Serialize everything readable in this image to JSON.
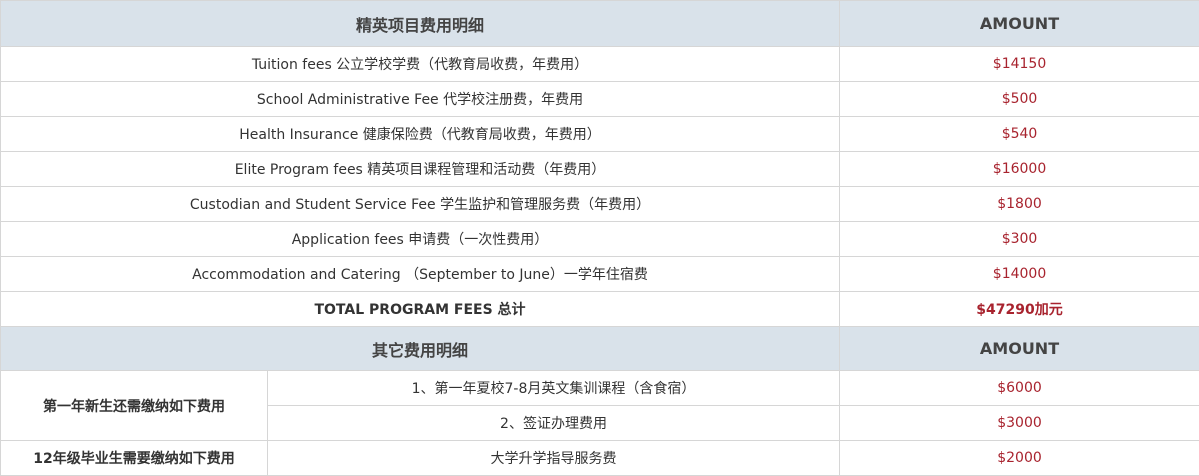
{
  "main_table": {
    "header": {
      "item": "精英项目费用明细",
      "amount": "AMOUNT"
    },
    "rows": [
      {
        "item": "Tuition fees 公立学校学费（代教育局收费，年费用）",
        "amount": "$14150"
      },
      {
        "item": "School Administrative Fee 代学校注册费，年费用",
        "amount": "$500"
      },
      {
        "item": "Health Insurance 健康保险费（代教育局收费，年费用）",
        "amount": "$540"
      },
      {
        "item": "Elite Program fees 精英项目课程管理和活动费（年费用）",
        "amount": "$16000"
      },
      {
        "item": "Custodian and Student Service Fee 学生监护和管理服务费（年费用）",
        "amount": "$1800"
      },
      {
        "item": "Application fees 申请费（一次性费用）",
        "amount": "$300"
      },
      {
        "item": "Accommodation and Catering （September to June）一学年住宿费",
        "amount": "$14000"
      }
    ],
    "total": {
      "label": "TOTAL PROGRAM FEES 总计",
      "amount": "$47290加元"
    }
  },
  "other_table": {
    "header": {
      "item": "其它费用明细",
      "amount": "AMOUNT"
    },
    "groups": [
      {
        "label": "第一年新生还需缴纳如下费用",
        "rows": [
          {
            "item": "1、第一年夏校7-8月英文集训课程（含食宿）",
            "amount": "$6000"
          },
          {
            "item": "2、签证办理费用",
            "amount": "$3000"
          }
        ]
      },
      {
        "label": "12年级毕业生需要缴纳如下费用",
        "rows": [
          {
            "item": "大学升学指导服务费",
            "amount": "$2000"
          }
        ]
      }
    ]
  },
  "colors": {
    "header_bg": "#d9e2ea",
    "amount_text": "#a8232e",
    "border": "#d6d6d6"
  }
}
